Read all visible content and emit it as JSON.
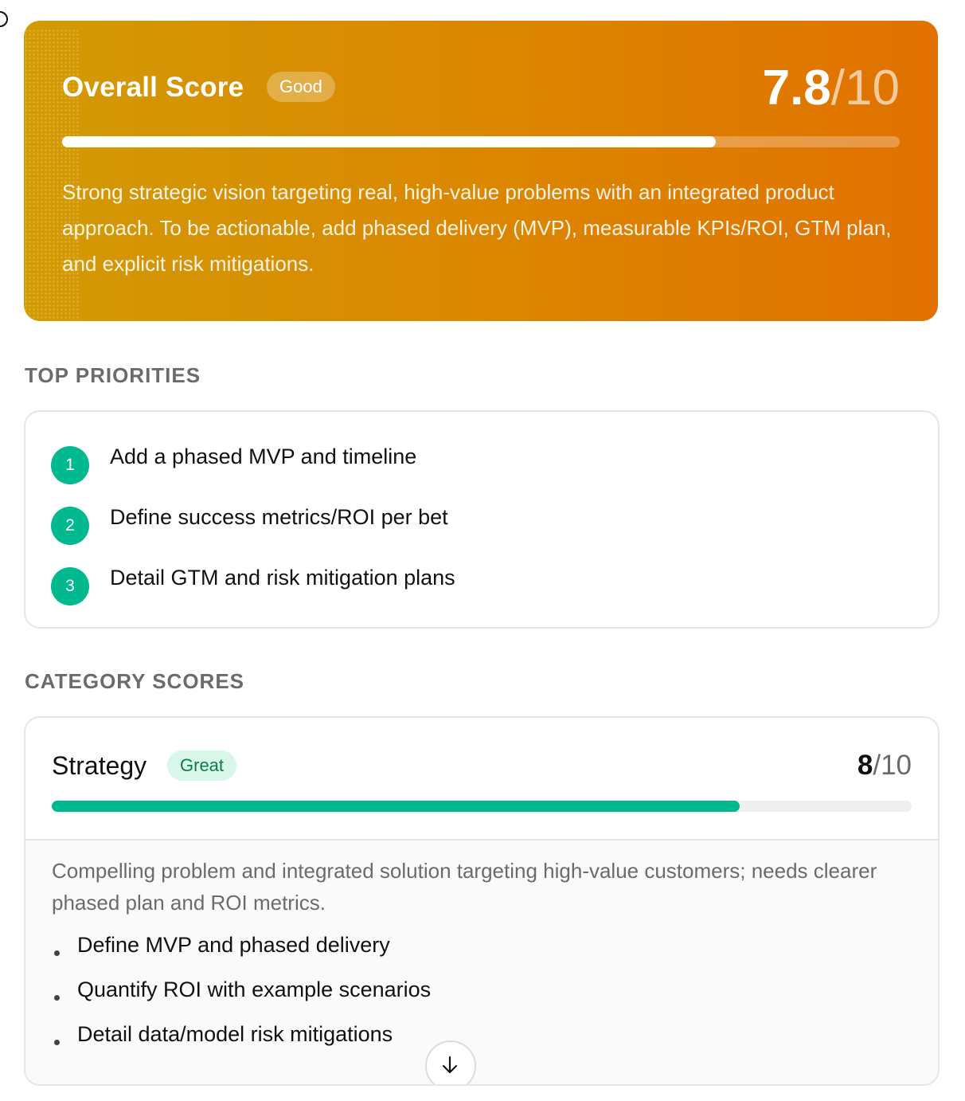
{
  "overall": {
    "title": "Overall Score",
    "badge": "Good",
    "score": "7.8",
    "max": "/10",
    "progress_fraction": 0.78,
    "description": "Strong strategic vision targeting real, high-value problems with an integrated product approach. To be actionable, add phased delivery (MVP), measurable KPIs/ROI, GTM plan, and explicit risk mitigations."
  },
  "priorities": {
    "heading": "TOP PRIORITIES",
    "items": [
      {
        "num": "1",
        "text": "Add a phased MVP and timeline"
      },
      {
        "num": "2",
        "text": "Define success metrics/ROI per bet"
      },
      {
        "num": "3",
        "text": "Detail GTM and risk mitigation plans"
      }
    ]
  },
  "categories": {
    "heading": "CATEGORY SCORES",
    "strategy": {
      "name": "Strategy",
      "badge": "Great",
      "score": "8",
      "max": "/10",
      "progress_fraction": 0.8,
      "summary": "Compelling problem and integrated solution targeting high-value customers; needs clearer phased plan and ROI metrics.",
      "bullets": [
        "Define MVP and phased delivery",
        "Quantify ROI with example scenarios",
        "Detail data/model risk mitigations"
      ]
    }
  },
  "icons": {
    "scroll": "arrow-down-icon"
  },
  "colors": {
    "accent_gradient_start": "#d29a05",
    "accent_gradient_end": "#e17100",
    "success": "#00b98f",
    "great_badge_bg": "#d8f6e9",
    "great_badge_text": "#0e7a53"
  }
}
